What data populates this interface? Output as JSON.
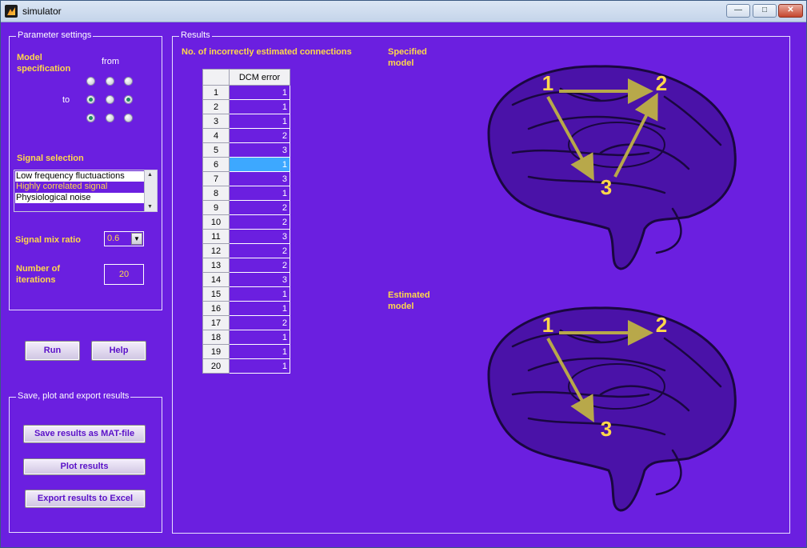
{
  "window": {
    "title": "simulator",
    "minimize": "—",
    "maximize": "□",
    "close": "✕"
  },
  "params": {
    "panel_title": "Parameter settings",
    "model_spec_line1": "Model",
    "model_spec_line2": "specification",
    "from_label": "from",
    "to_label": "to",
    "radios": [
      [
        false,
        false,
        false
      ],
      [
        true,
        false,
        true
      ],
      [
        true,
        false,
        false
      ]
    ],
    "signal_selection_label": "Signal selection",
    "signal_options": [
      "Low frequency fluctuactions",
      "Highly correlated signal",
      "Physiological noise"
    ],
    "signal_selected": "Highly correlated signal",
    "mix_ratio_label": "Signal mix ratio",
    "mix_ratio_value": "0.6",
    "iterations_line1": "Number of",
    "iterations_line2": "iterations",
    "iterations_value": "20"
  },
  "actions": {
    "run": "Run",
    "help": "Help"
  },
  "export": {
    "panel_title": "Save, plot and export results",
    "save_mat": "Save results as MAT-file",
    "plot": "Plot results",
    "excel": "Export results to Excel"
  },
  "results": {
    "panel_title": "Results",
    "table_title": "No. of incorrectly estimated connections",
    "column_header": "DCM error",
    "rows": [
      {
        "n": "1",
        "v": "1"
      },
      {
        "n": "2",
        "v": "1"
      },
      {
        "n": "3",
        "v": "1"
      },
      {
        "n": "4",
        "v": "2"
      },
      {
        "n": "5",
        "v": "3"
      },
      {
        "n": "6",
        "v": "1"
      },
      {
        "n": "7",
        "v": "3"
      },
      {
        "n": "8",
        "v": "1"
      },
      {
        "n": "9",
        "v": "2"
      },
      {
        "n": "10",
        "v": "2"
      },
      {
        "n": "11",
        "v": "3"
      },
      {
        "n": "12",
        "v": "2"
      },
      {
        "n": "13",
        "v": "2"
      },
      {
        "n": "14",
        "v": "3"
      },
      {
        "n": "15",
        "v": "1"
      },
      {
        "n": "16",
        "v": "1"
      },
      {
        "n": "17",
        "v": "2"
      },
      {
        "n": "18",
        "v": "1"
      },
      {
        "n": "19",
        "v": "1"
      },
      {
        "n": "20",
        "v": "1"
      }
    ],
    "highlighted_row": 6,
    "specified_model_line1": "Specified",
    "specified_model_line2": "model",
    "estimated_model_line1": "Estimated",
    "estimated_model_line2": "model",
    "node_labels": [
      "1",
      "2",
      "3"
    ]
  },
  "colors": {
    "background": "#6b1fe0",
    "label_yellow": "#ffd84a",
    "highlight_cell": "#3da8ff",
    "arrow": "#b8a84a"
  }
}
